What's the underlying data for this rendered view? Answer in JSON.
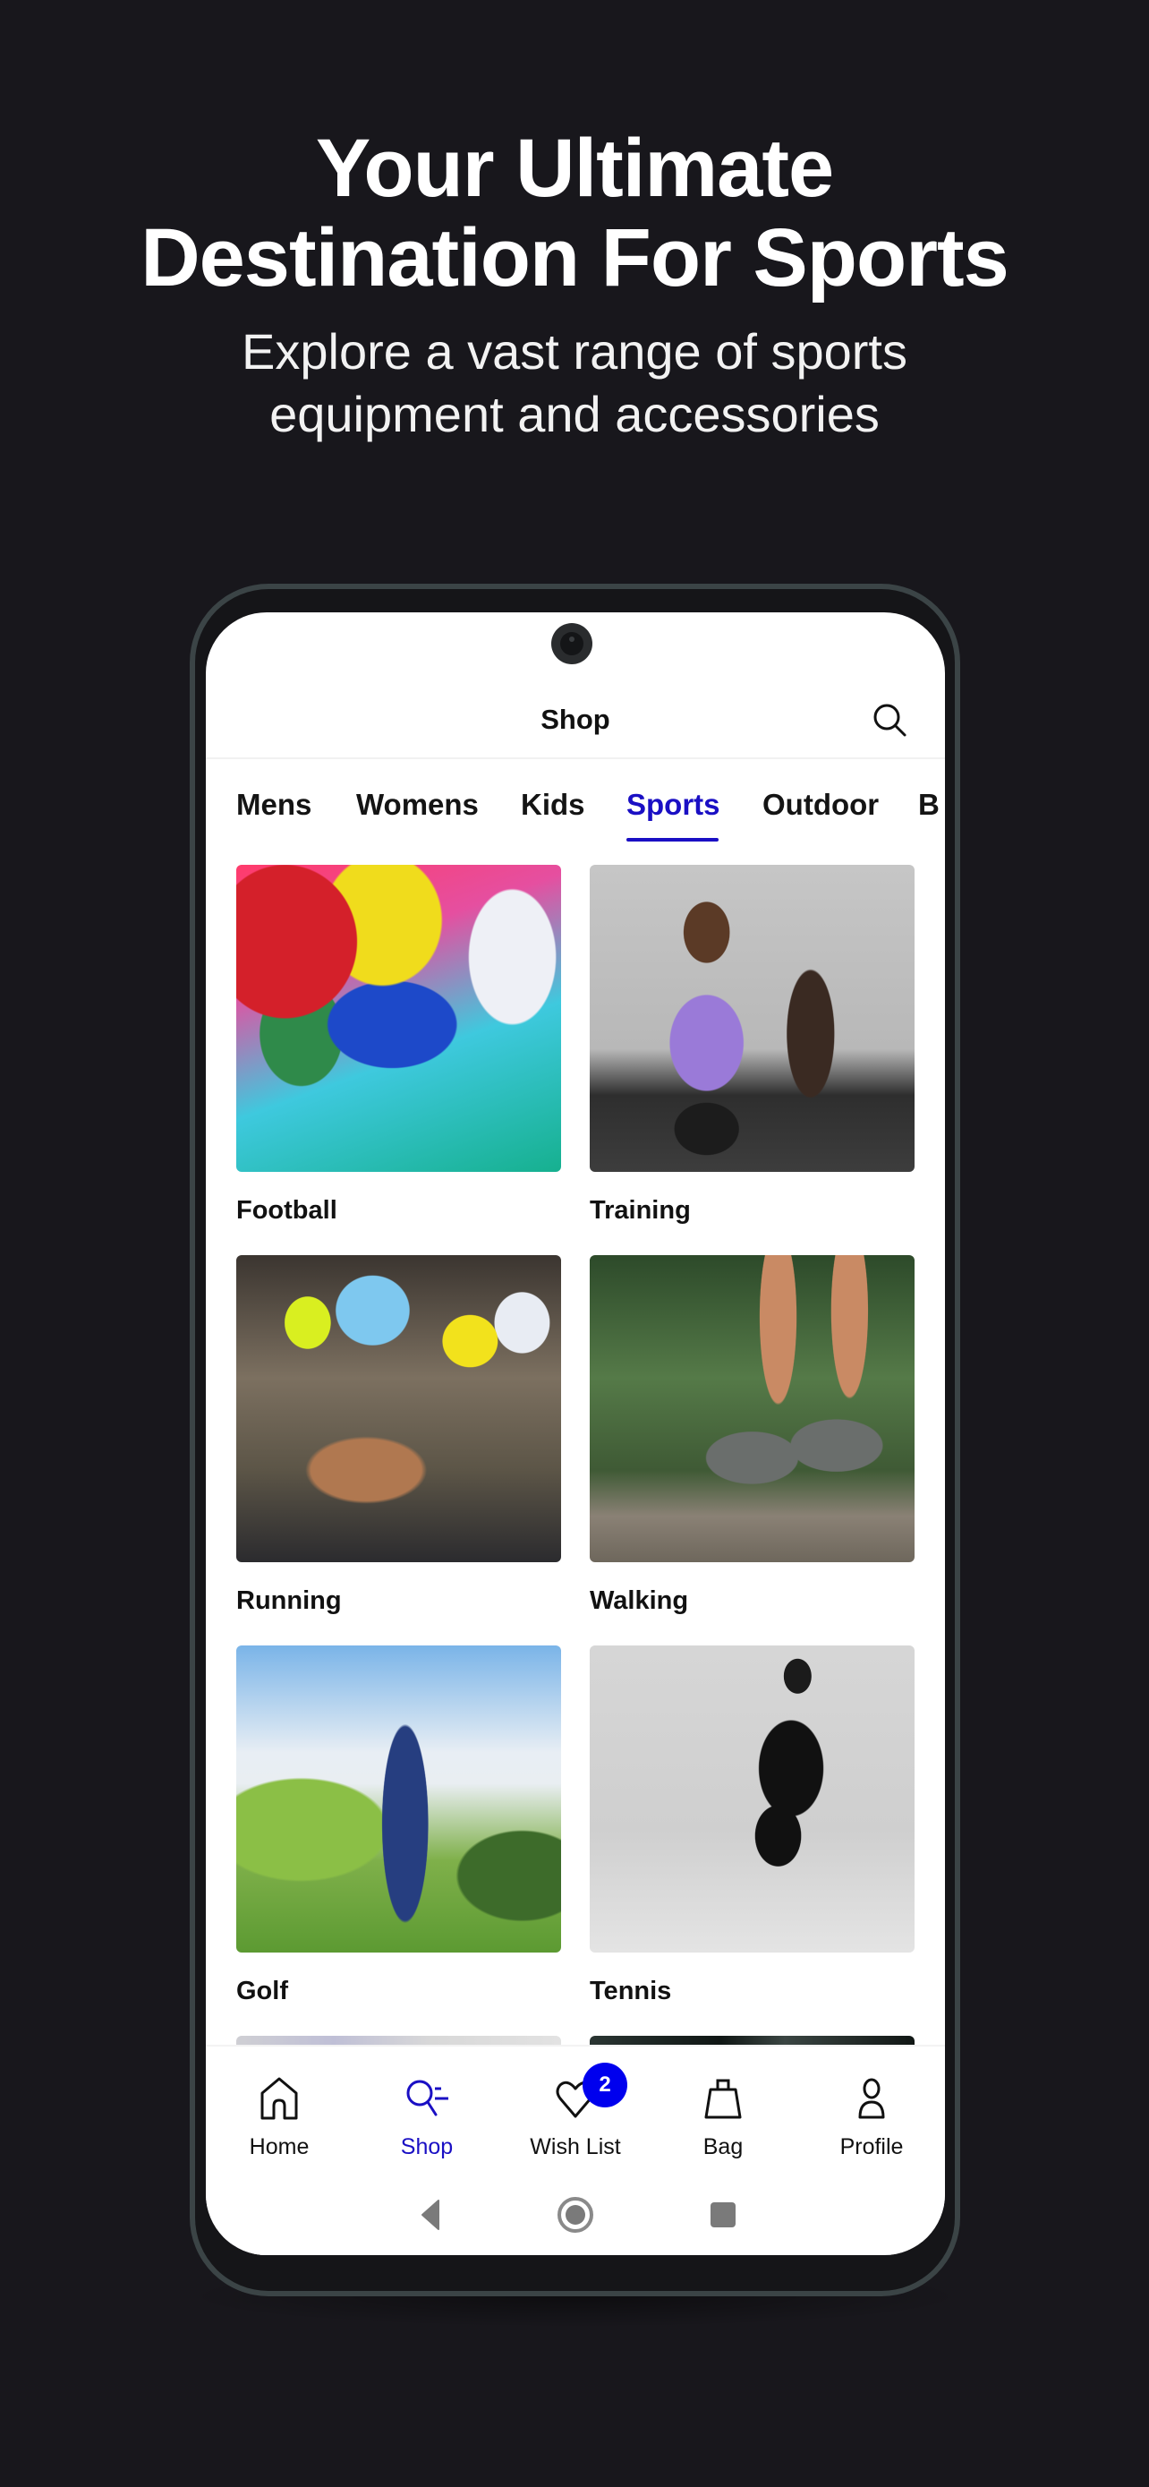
{
  "hero": {
    "title_line1": "Your Ultimate",
    "title_line2": "Destination For Sports",
    "subtitle_line1": "Explore a vast range of sports",
    "subtitle_line2": "equipment and accessories"
  },
  "colors": {
    "background": "#18171c",
    "accent": "#1a0fc4",
    "badge": "#0000ee",
    "frame": "#3b4446"
  },
  "header": {
    "title": "Shop",
    "search_icon": "search-icon"
  },
  "tabs": [
    {
      "label": "Mens",
      "active": false
    },
    {
      "label": "Womens",
      "active": false
    },
    {
      "label": "Kids",
      "active": false
    },
    {
      "label": "Sports",
      "active": true
    },
    {
      "label": "Outdoor",
      "active": false
    },
    {
      "label": "B",
      "active": false
    }
  ],
  "categories": [
    {
      "label": "Football"
    },
    {
      "label": "Training"
    },
    {
      "label": "Running"
    },
    {
      "label": "Walking"
    },
    {
      "label": "Golf"
    },
    {
      "label": "Tennis"
    }
  ],
  "bottom_nav": {
    "items": [
      {
        "label": "Home",
        "icon": "home-icon",
        "active": false
      },
      {
        "label": "Shop",
        "icon": "shop-search-icon",
        "active": true
      },
      {
        "label": "Wish List",
        "icon": "heart-icon",
        "active": false,
        "badge": "2"
      },
      {
        "label": "Bag",
        "icon": "bag-icon",
        "active": false
      },
      {
        "label": "Profile",
        "icon": "profile-icon",
        "active": false
      }
    ]
  },
  "system_nav": {
    "back_icon": "back-triangle-icon",
    "home_icon": "home-circle-icon",
    "recents_icon": "recents-square-icon"
  }
}
